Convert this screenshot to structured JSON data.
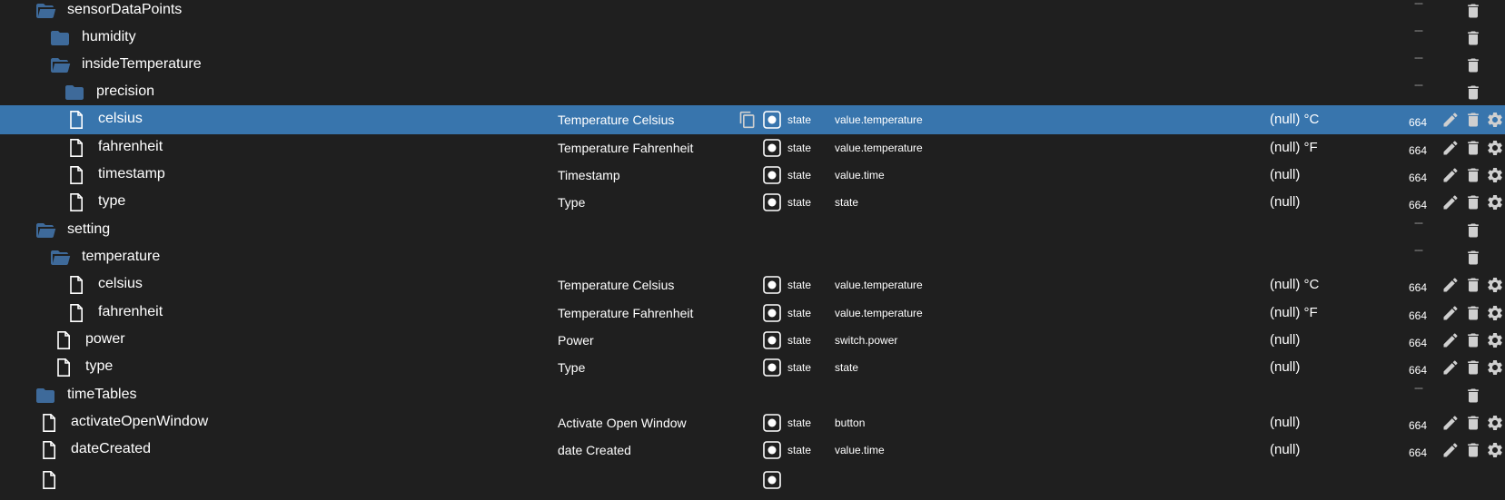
{
  "rows": [
    {
      "name": "sensorDataPoints",
      "type": "folder-open",
      "desc": "",
      "kind": "",
      "role": "",
      "value": "",
      "acl": "---",
      "selected": false
    },
    {
      "name": "humidity",
      "type": "folder",
      "desc": "",
      "kind": "",
      "role": "",
      "value": "",
      "acl": "---",
      "selected": false
    },
    {
      "name": "insideTemperature",
      "type": "folder-open",
      "desc": "",
      "kind": "",
      "role": "",
      "value": "",
      "acl": "---",
      "selected": false
    },
    {
      "name": "precision",
      "type": "folder",
      "desc": "",
      "kind": "",
      "role": "",
      "value": "",
      "acl": "---",
      "selected": false
    },
    {
      "name": "celsius",
      "type": "file",
      "desc": "Temperature Celsius",
      "kind": "state",
      "role": "value.temperature",
      "value": "(null) °C",
      "acl": "664",
      "selected": true
    },
    {
      "name": "fahrenheit",
      "type": "file",
      "desc": "Temperature Fahrenheit",
      "kind": "state",
      "role": "value.temperature",
      "value": "(null) °F",
      "acl": "664",
      "selected": false
    },
    {
      "name": "timestamp",
      "type": "file",
      "desc": "Timestamp",
      "kind": "state",
      "role": "value.time",
      "value": "(null)",
      "acl": "664",
      "selected": false
    },
    {
      "name": "type",
      "type": "file",
      "desc": "Type",
      "kind": "state",
      "role": "state",
      "value": "(null)",
      "acl": "664",
      "selected": false
    },
    {
      "name": "setting",
      "type": "folder-open",
      "desc": "",
      "kind": "",
      "role": "",
      "value": "",
      "acl": "---",
      "selected": false
    },
    {
      "name": "temperature",
      "type": "folder-open",
      "desc": "",
      "kind": "",
      "role": "",
      "value": "",
      "acl": "---",
      "selected": false
    },
    {
      "name": "celsius",
      "type": "file",
      "desc": "Temperature Celsius",
      "kind": "state",
      "role": "value.temperature",
      "value": "(null) °C",
      "acl": "664",
      "selected": false
    },
    {
      "name": "fahrenheit",
      "type": "file",
      "desc": "Temperature Fahrenheit",
      "kind": "state",
      "role": "value.temperature",
      "value": "(null) °F",
      "acl": "664",
      "selected": false
    },
    {
      "name": "power",
      "type": "file",
      "desc": "Power",
      "kind": "state",
      "role": "switch.power",
      "value": "(null)",
      "acl": "664",
      "selected": false
    },
    {
      "name": "type",
      "type": "file",
      "desc": "Type",
      "kind": "state",
      "role": "state",
      "value": "(null)",
      "acl": "664",
      "selected": false
    },
    {
      "name": "timeTables",
      "type": "folder",
      "desc": "",
      "kind": "",
      "role": "",
      "value": "",
      "acl": "---",
      "selected": false
    },
    {
      "name": "activateOpenWindow",
      "type": "file",
      "desc": "Activate Open Window",
      "kind": "state",
      "role": "button",
      "value": "(null)",
      "acl": "664",
      "selected": false
    },
    {
      "name": "dateCreated",
      "type": "file",
      "desc": "date Created",
      "kind": "state",
      "role": "value.time",
      "value": "(null)",
      "acl": "664",
      "selected": false
    },
    {
      "name": "",
      "type": "file",
      "desc": "",
      "kind": "",
      "role": "",
      "value": "",
      "acl": "",
      "selected": false
    }
  ],
  "colors": {
    "selected": "#3875ad",
    "folder": "#3e6a9a",
    "background": "#1f1f1f",
    "icon": "#cfcfcf"
  }
}
